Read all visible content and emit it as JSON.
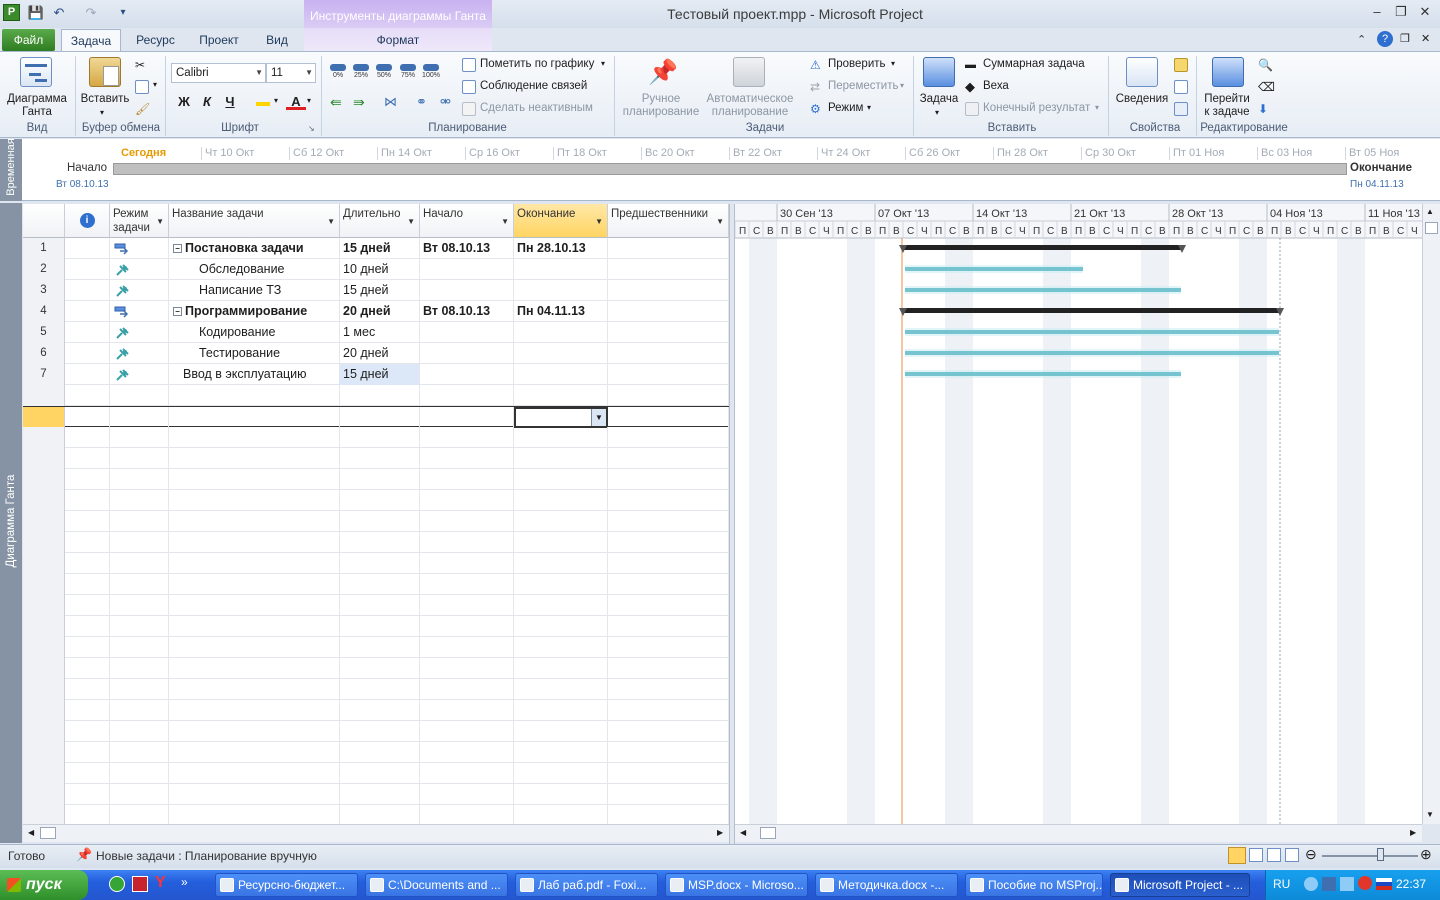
{
  "window": {
    "title": "Тестовый проект.mpp  -  Microsoft Project",
    "app_icon_letter": "P",
    "contextual_tab_header": "Инструменты диаграммы Ганта"
  },
  "ribbon_tabs": {
    "file": "Файл",
    "tabs": [
      "Задача",
      "Ресурс",
      "Проект",
      "Вид"
    ],
    "contextual": "Формат"
  },
  "ribbon": {
    "view_group": {
      "button": "Диаграмма\nГанта",
      "label": "Вид"
    },
    "clipboard_group": {
      "paste": "Вставить",
      "label": "Буфер обмена"
    },
    "font_group": {
      "font_name": "Calibri",
      "font_size": "11",
      "bold": "Ж",
      "italic": "К",
      "underline": "Ч",
      "label": "Шрифт"
    },
    "schedule_group": {
      "percent_buttons": [
        "0%",
        "25%",
        "50%",
        "75%",
        "100%"
      ],
      "mark_on_track": "Пометить по графику",
      "respect_links": "Соблюдение связей",
      "inactivate": "Сделать неактивным",
      "label": "Планирование"
    },
    "tasks_group": {
      "manual": "Ручное\nпланирование",
      "auto": "Автоматическое\nпланирование",
      "inspect": "Проверить",
      "move": "Переместить",
      "mode": "Режим",
      "label": "Задачи"
    },
    "insert_group": {
      "task": "Задача",
      "summary": "Суммарная задача",
      "milestone": "Веха",
      "deliverable": "Конечный результат",
      "label": "Вставить"
    },
    "properties_group": {
      "information": "Сведения",
      "label": "Свойства"
    },
    "editing_group": {
      "scroll_to_task": "Перейти\nк задаче",
      "label": "Редактирование"
    }
  },
  "timeline": {
    "side_label": "Временная",
    "today": "Сегодня",
    "dates": [
      "Чт 10 Окт",
      "Сб 12 Окт",
      "Пн 14 Окт",
      "Ср 16 Окт",
      "Пт 18 Окт",
      "Вс 20 Окт",
      "Вт 22 Окт",
      "Чт 24 Окт",
      "Сб 26 Окт",
      "Пн 28 Окт",
      "Ср 30 Окт",
      "Пт 01 Ноя",
      "Вс 03 Ноя",
      "Вт 05 Ноя"
    ],
    "start_label": "Начало",
    "start_date": "Вт 08.10.13",
    "end_label": "Окончание",
    "end_date": "Пн 04.11.13"
  },
  "view_bar_label": "Диаграмма Ганта",
  "grid": {
    "columns": [
      "",
      "Режим\nзадачи",
      "Название задачи",
      "Длительно",
      "Начало",
      "Окончание",
      "Предшественники"
    ],
    "rows": [
      {
        "id": "1",
        "name": "Постановка задачи",
        "duration": "15 дней",
        "start": "Вт 08.10.13",
        "finish": "Пн 28.10.13",
        "summary": true,
        "indent": 0
      },
      {
        "id": "2",
        "name": "Обследование",
        "duration": "10 дней",
        "start": "",
        "finish": "",
        "summary": false,
        "indent": 1
      },
      {
        "id": "3",
        "name": "Написание ТЗ",
        "duration": "15 дней",
        "start": "",
        "finish": "",
        "summary": false,
        "indent": 1
      },
      {
        "id": "4",
        "name": "Программирование",
        "duration": "20 дней",
        "start": "Вт 08.10.13",
        "finish": "Пн 04.11.13",
        "summary": true,
        "indent": 0
      },
      {
        "id": "5",
        "name": "Кодирование",
        "duration": "1 мес",
        "start": "",
        "finish": "",
        "summary": false,
        "indent": 1
      },
      {
        "id": "6",
        "name": "Тестирование",
        "duration": "20 дней",
        "start": "",
        "finish": "",
        "summary": false,
        "indent": 1
      },
      {
        "id": "7",
        "name": "Ввод в эксплуатацию",
        "duration": "15 дней",
        "start": "",
        "finish": "",
        "summary": false,
        "indent": 0
      }
    ]
  },
  "gantt": {
    "weeks": [
      "30 Сен '13",
      "07 Окт '13",
      "14 Окт '13",
      "21 Окт '13",
      "28 Окт '13",
      "04 Ноя '13",
      "11 Ноя '13"
    ],
    "day_letters": [
      "П",
      "В",
      "С",
      "Ч",
      "П",
      "С",
      "В"
    ]
  },
  "status_bar": {
    "ready": "Готово",
    "new_tasks": "Новые задачи : Планирование вручную"
  },
  "taskbar": {
    "start": "пуск",
    "items": [
      "Ресурсно-бюджет...",
      "C:\\Documents and ...",
      "Лаб раб.pdf - Foxi...",
      "MSP.docx - Microso...",
      "Методичка.docx -...",
      "Пособие по MSProj...",
      "Microsoft Project - ..."
    ],
    "lang": "RU",
    "clock": "22:37"
  }
}
